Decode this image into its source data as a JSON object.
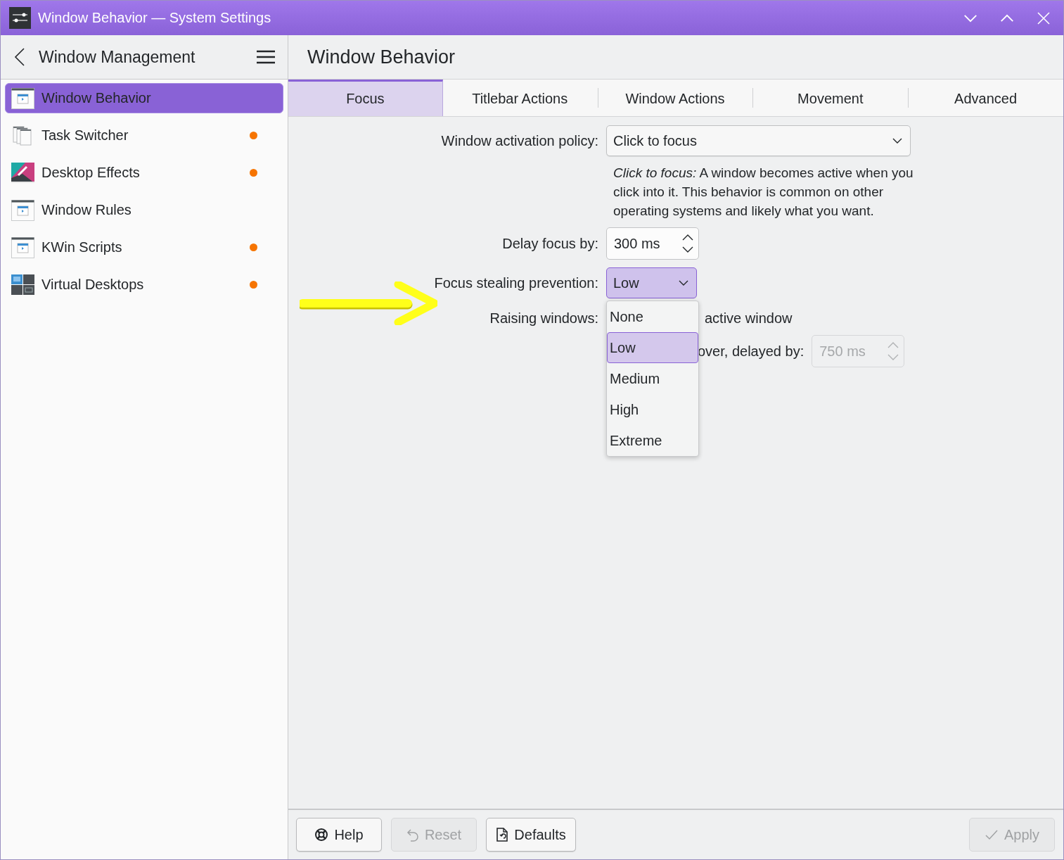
{
  "window": {
    "title": "Window Behavior — System Settings"
  },
  "sidebar": {
    "header": "Window Management",
    "items": [
      {
        "label": "Window Behavior",
        "selected": true,
        "modified": false
      },
      {
        "label": "Task Switcher",
        "selected": false,
        "modified": true
      },
      {
        "label": "Desktop Effects",
        "selected": false,
        "modified": true
      },
      {
        "label": "Window Rules",
        "selected": false,
        "modified": false
      },
      {
        "label": "KWin Scripts",
        "selected": false,
        "modified": true
      },
      {
        "label": "Virtual Desktops",
        "selected": false,
        "modified": true
      }
    ]
  },
  "page": {
    "title": "Window Behavior"
  },
  "tabs": [
    {
      "label": "Focus",
      "selected": true
    },
    {
      "label": "Titlebar Actions",
      "selected": false
    },
    {
      "label": "Window Actions",
      "selected": false
    },
    {
      "label": "Movement",
      "selected": false
    },
    {
      "label": "Advanced",
      "selected": false
    }
  ],
  "form": {
    "activation_policy": {
      "label": "Window activation policy:",
      "value": "Click to focus"
    },
    "description": "*Click to focus:* A window becomes active when you click into it. This behavior is common on other operating systems and likely what you want.",
    "delay": {
      "label": "Delay focus by:",
      "value": "300 ms"
    },
    "focus_stealing": {
      "label": "Focus stealing prevention:",
      "value": "Low",
      "expanded": true,
      "options": [
        {
          "label": "None",
          "selected": false
        },
        {
          "label": "Low",
          "selected": true
        },
        {
          "label": "Medium",
          "selected": false
        },
        {
          "label": "High",
          "selected": false
        },
        {
          "label": "Extreme",
          "selected": false
        }
      ]
    },
    "raising": {
      "label": "Raising windows:",
      "option_1_text": "active window",
      "option_2_text": "over, delayed by:",
      "hover_delay": {
        "value": "750 ms",
        "disabled": true
      }
    }
  },
  "buttons": [
    {
      "label": "Help",
      "disabled": false
    },
    {
      "label": "Reset",
      "disabled": true
    },
    {
      "label": "Defaults",
      "disabled": false
    },
    {
      "label": "Apply",
      "disabled": true
    }
  ]
}
